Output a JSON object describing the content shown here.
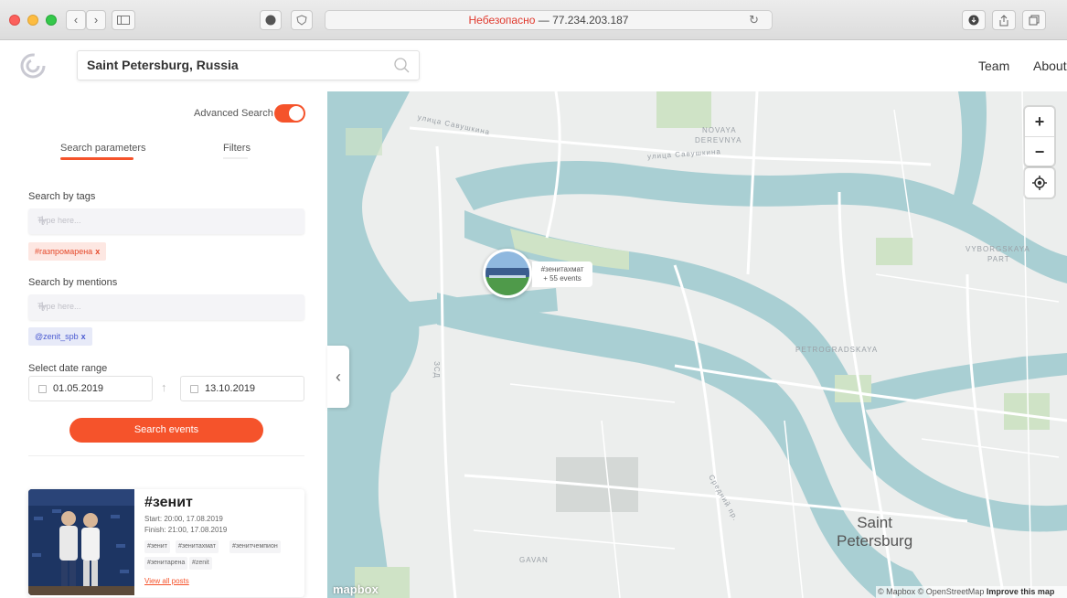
{
  "browser": {
    "url_warning": "Небезопасно",
    "url_separator": "—",
    "url_host": "77.234.203.187"
  },
  "header": {
    "search_value": "Saint Petersburg, Russia",
    "nav": [
      "Team",
      "About"
    ]
  },
  "sidebar": {
    "advanced_search_label": "Advanced Search",
    "advanced_search_on": true,
    "tabs": [
      "Search parameters",
      "Filters"
    ],
    "active_tab": 0,
    "tags_label": "Search by tags",
    "tags_placeholder": "Type here...",
    "tags": [
      "#газпромарена"
    ],
    "mentions_label": "Search by mentions",
    "mentions_placeholder": "Type here...",
    "mentions": [
      "@zenit_spb"
    ],
    "chip_remove": "x",
    "date_label": "Select date range",
    "date_from": "01.05.2019",
    "date_to": "13.10.2019",
    "search_button": "Search events"
  },
  "event_card": {
    "title": "#зенит",
    "start": "Start: 20:00, 17.08.2019",
    "finish": "Finish: 21:00, 17.08.2019",
    "tags": [
      "#зенит",
      "#зенитахмат",
      "#зенитчемпион",
      "#зенитарена",
      "#zenit"
    ],
    "view_all": "View all posts"
  },
  "map": {
    "zoom_in": "+",
    "zoom_out": "−",
    "cluster_tag": "#зенитахмат",
    "cluster_count": "+ 55 events",
    "labels": {
      "street1": "улица Савушкина",
      "street2": "улица Савушкина",
      "novaya1": "NOVAYA",
      "novaya2": "DEREVNYA",
      "vyborgskaya1": "VYBORGSKAYA",
      "vyborgskaya2": "PART",
      "petrogradskaya": "PETROGRADSKAYA",
      "gavan": "GAVAN",
      "zsd": "ЗСД",
      "street3": "Средний пр."
    },
    "city_line1": "Saint",
    "city_line2": "Petersburg",
    "mapbox_logo": "mapbox",
    "attribution": "© Mapbox © OpenStreetMap",
    "improve": "Improve this map"
  },
  "colors": {
    "accent": "#f5532b",
    "water": "#a9cfd3",
    "park": "#cfe3c6",
    "land": "#eceeed"
  }
}
